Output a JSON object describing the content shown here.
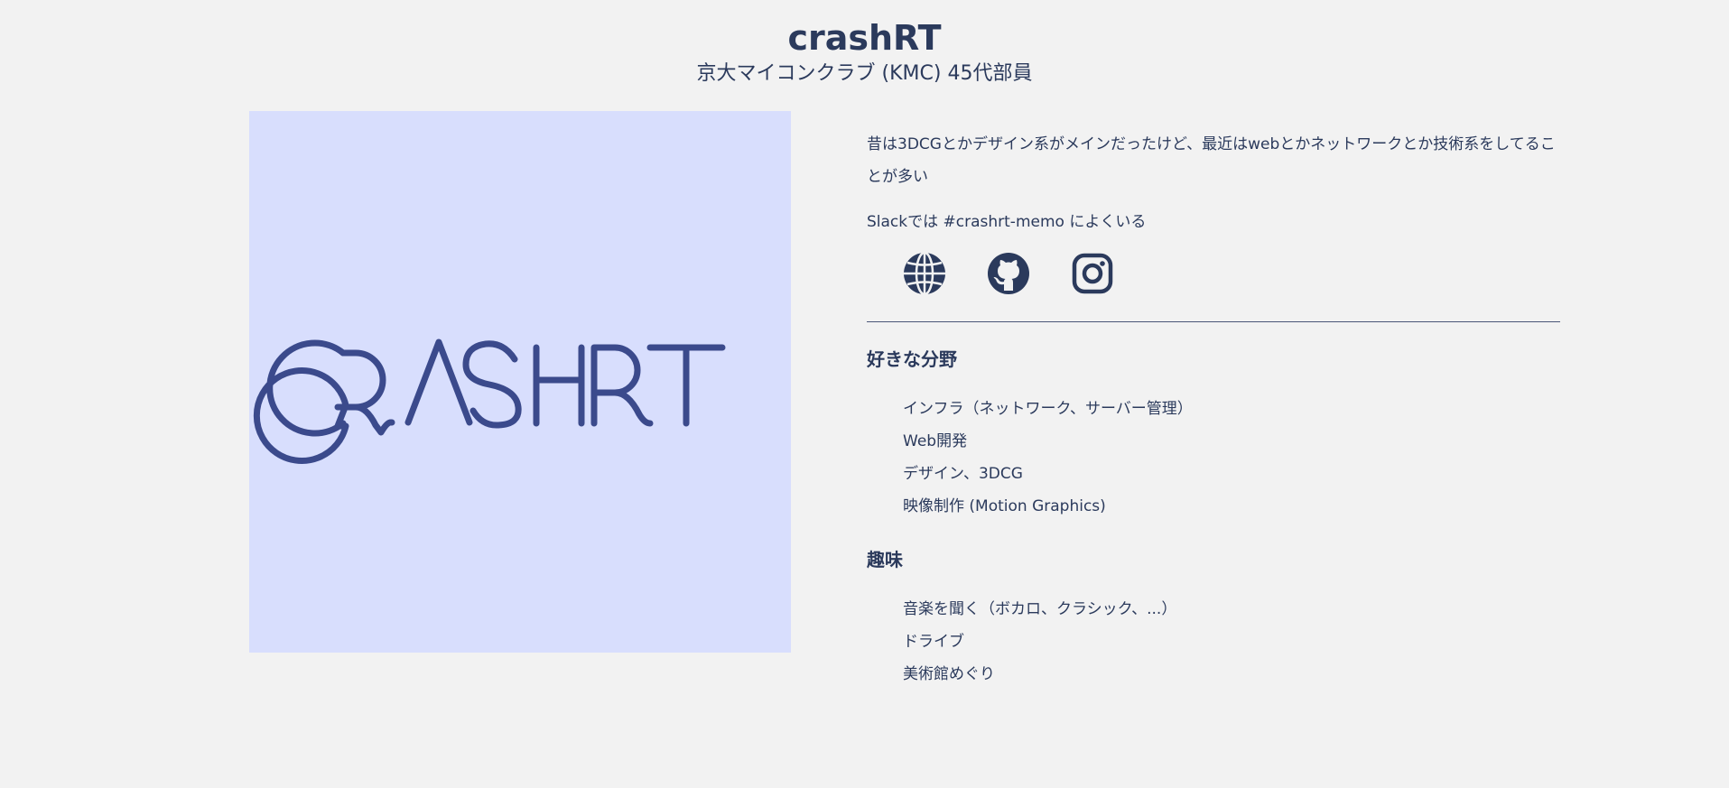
{
  "header": {
    "name": "crashRT",
    "affiliation": "京大マイコンクラブ (KMC) 45代部員"
  },
  "logo": {
    "wordmark": "CRASHRT",
    "background_color": "#d8defd",
    "stroke_color": "#3b4a8c"
  },
  "profile": {
    "bio": "昔は3DCGとかデザイン系がメインだったけど、最近はwebとかネットワークとか技術系をしてることが多い",
    "slack": "Slackでは #crashrt-memo によくいる"
  },
  "socials": [
    {
      "icon": "globe-icon"
    },
    {
      "icon": "github-icon"
    },
    {
      "icon": "instagram-icon"
    }
  ],
  "interests": {
    "heading": "好きな分野",
    "items": [
      "インフラ（ネットワーク、サーバー管理）",
      "Web開発",
      "デザイン、3DCG",
      "映像制作 (Motion Graphics)"
    ]
  },
  "hobbies": {
    "heading": "趣味",
    "items": [
      "音楽を聞く（ボカロ、クラシック、...）",
      "ドライブ",
      "美術館めぐり"
    ]
  },
  "colors": {
    "background": "#f2f2f2",
    "text": "#2b3a5c"
  }
}
